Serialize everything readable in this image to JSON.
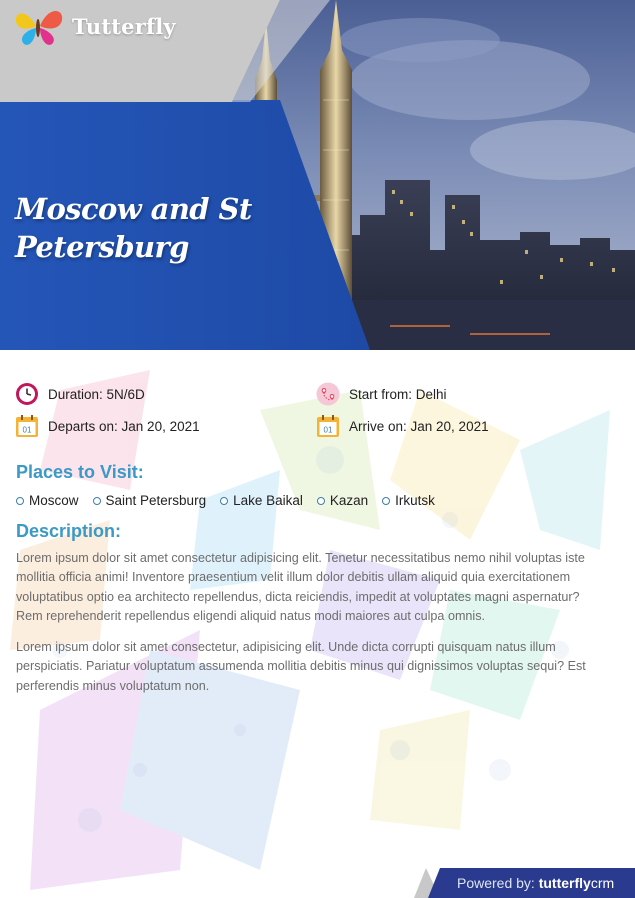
{
  "brand": {
    "name": "Tutterfly"
  },
  "hero": {
    "title": "Moscow and St Petersburg"
  },
  "details": {
    "duration": "Duration: 5N/6D",
    "start": "Start from: Delhi",
    "departs": "Departs on: Jan 20, 2021",
    "arrive": "Arrive on: Jan 20, 2021"
  },
  "places": {
    "heading": "Places to Visit:",
    "items": [
      "Moscow",
      "Saint Petersburg",
      "Lake Baikal",
      "Kazan",
      "Irkutsk"
    ]
  },
  "description": {
    "heading": "Description:",
    "paragraphs": [
      "Lorem ipsum dolor sit amet consectetur adipisicing elit. Tenetur necessitatibus nemo nihil voluptas iste mollitia officia animi! Inventore praesentium velit illum dolor debitis ullam aliquid quia exercitationem voluptatibus optio ea architecto repellendus, dicta reiciendis, impedit at voluptates magni aspernatur? Rem reprehenderit repellendus eligendi aliquid natus modi maiores aut culpa omnis.",
      "Lorem ipsum dolor sit amet consectetur, adipisicing elit. Unde dicta corrupti quisquam natus illum perspiciatis. Pariatur voluptatum assumenda mollitia debitis minus qui dignissimos voluptas sequi? Est perferendis minus voluptatum non."
    ]
  },
  "calendar_day": "01",
  "footer": {
    "label": "Powered by:",
    "brand_bold": "tutterfly",
    "brand_rest": "crm"
  },
  "colors": {
    "accent": "#3b99c6",
    "hero_blue": "#2154b4",
    "footer_blue": "#2a3b8f",
    "body_text": "#6d6d6d"
  },
  "icons": [
    "butterfly-logo-icon",
    "clock-icon",
    "location-pin-icon",
    "calendar-icon"
  ]
}
